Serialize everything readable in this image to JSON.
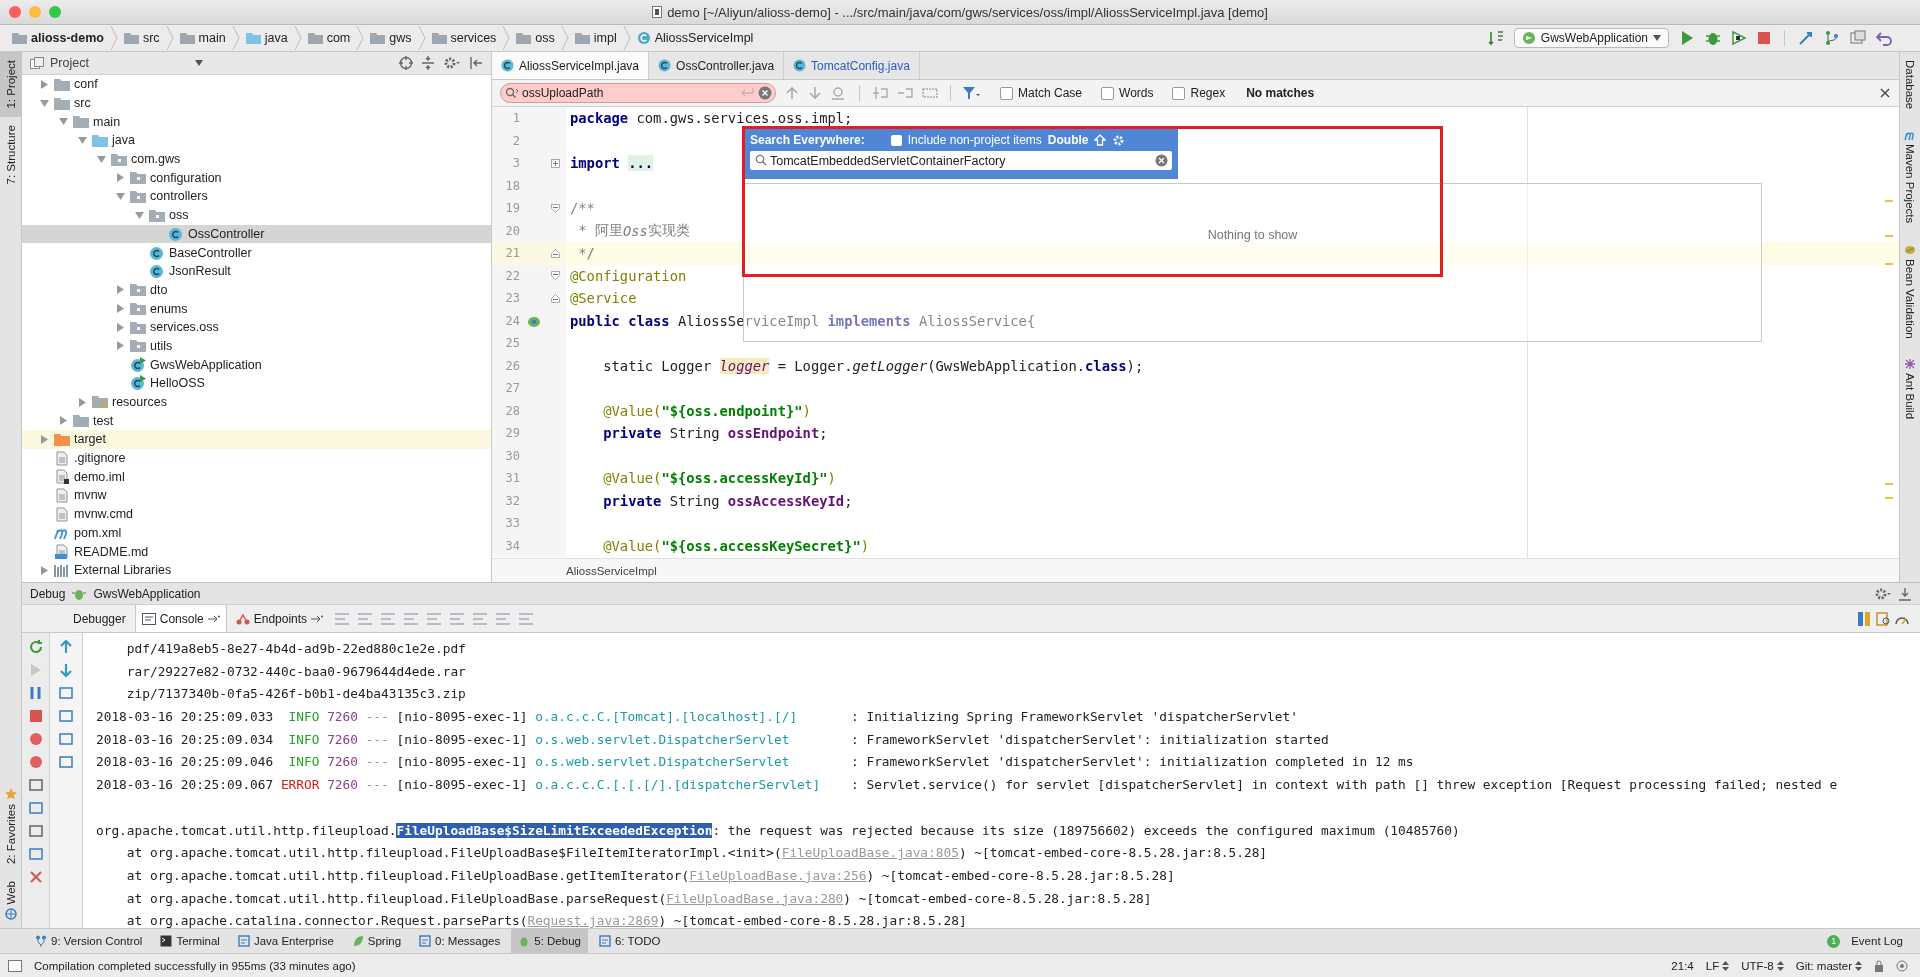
{
  "window": {
    "title": "demo [~/Aliyun/alioss-demo] - .../src/main/java/com/gws/services/oss/impl/AliossServiceImpl.java [demo]"
  },
  "breadcrumbs": [
    {
      "label": "alioss-demo",
      "kind": "module"
    },
    {
      "label": "src",
      "kind": "folder"
    },
    {
      "label": "main",
      "kind": "folder"
    },
    {
      "label": "java",
      "kind": "source"
    },
    {
      "label": "com",
      "kind": "folder"
    },
    {
      "label": "gws",
      "kind": "folder"
    },
    {
      "label": "services",
      "kind": "folder"
    },
    {
      "label": "oss",
      "kind": "folder"
    },
    {
      "label": "impl",
      "kind": "folder"
    },
    {
      "label": "AliossServiceImpl",
      "kind": "class"
    }
  ],
  "run_config": {
    "label": "GwsWebApplication"
  },
  "left_tool_strip": [
    {
      "label": "1: Project",
      "selected": true,
      "kind": "project"
    },
    {
      "label": "7: Structure",
      "selected": false,
      "kind": "structure"
    },
    {
      "label": "2: Favorites",
      "selected": false,
      "kind": "favorites"
    },
    {
      "label": "Web",
      "selected": false,
      "kind": "web"
    }
  ],
  "project_panel": {
    "title": "Project",
    "tree": [
      {
        "label": "conf",
        "kind": "folder",
        "expanded": false,
        "selected": false
      },
      {
        "label": "src",
        "kind": "folder",
        "expanded": true,
        "selected": false,
        "children": [
          {
            "label": "main",
            "kind": "folder",
            "expanded": true,
            "selected": false,
            "children": [
              {
                "label": "java",
                "kind": "source",
                "expanded": true,
                "selected": false,
                "children": [
                  {
                    "label": "com.gws",
                    "kind": "package",
                    "expanded": true,
                    "selected": false,
                    "children": [
                      {
                        "label": "configuration",
                        "kind": "package",
                        "expanded": false,
                        "selected": false
                      },
                      {
                        "label": "controllers",
                        "kind": "package",
                        "expanded": true,
                        "selected": false,
                        "children": [
                          {
                            "label": "oss",
                            "kind": "package",
                            "expanded": true,
                            "selected": false,
                            "children": [
                              {
                                "label": "OssController",
                                "kind": "class",
                                "selected": true
                              }
                            ]
                          },
                          {
                            "label": "BaseController",
                            "kind": "class",
                            "selected": false
                          },
                          {
                            "label": "JsonResult",
                            "kind": "class",
                            "selected": false
                          }
                        ]
                      },
                      {
                        "label": "dto",
                        "kind": "package",
                        "expanded": false,
                        "selected": false
                      },
                      {
                        "label": "enums",
                        "kind": "package",
                        "expanded": false,
                        "selected": false
                      },
                      {
                        "label": "services.oss",
                        "kind": "package",
                        "expanded": false,
                        "selected": false
                      },
                      {
                        "label": "utils",
                        "kind": "package",
                        "expanded": false,
                        "selected": false
                      },
                      {
                        "label": "GwsWebApplication",
                        "kind": "app-class",
                        "selected": false
                      },
                      {
                        "label": "HelloOSS",
                        "kind": "app-class",
                        "selected": false
                      }
                    ]
                  }
                ]
              },
              {
                "label": "resources",
                "kind": "resources",
                "expanded": false,
                "selected": false
              }
            ]
          },
          {
            "label": "test",
            "kind": "folder",
            "expanded": false,
            "selected": false
          }
        ]
      },
      {
        "label": "target",
        "kind": "excluded",
        "expanded": false,
        "selected": false
      },
      {
        "label": ".gitignore",
        "kind": "file",
        "selected": false
      },
      {
        "label": "demo.iml",
        "kind": "module-file",
        "selected": false
      },
      {
        "label": "mvnw",
        "kind": "file",
        "selected": false
      },
      {
        "label": "mvnw.cmd",
        "kind": "file",
        "selected": false
      },
      {
        "label": "pom.xml",
        "kind": "maven",
        "selected": false
      },
      {
        "label": "README.md",
        "kind": "markdown",
        "selected": false
      },
      {
        "label": "External Libraries",
        "kind": "library",
        "expanded": false,
        "selected": false
      }
    ]
  },
  "editor": {
    "tabs": [
      {
        "label": "AliossServiceImpl.java",
        "selected": true,
        "modified": false
      },
      {
        "label": "OssController.java",
        "selected": false,
        "modified": false
      },
      {
        "label": "TomcatConfig.java",
        "selected": false,
        "modified": true
      }
    ],
    "find_bar": {
      "value": "ossUploadPath",
      "match_found": false,
      "options": [
        {
          "label": "Match Case",
          "checked": false
        },
        {
          "label": "Words",
          "checked": false
        },
        {
          "label": "Regex",
          "checked": false
        }
      ],
      "result": "No matches"
    },
    "lines": [
      {
        "number": "1",
        "current": false,
        "tokens": [
          {
            "kind": "kw",
            "text": "package"
          },
          {
            "kind": "plain",
            "text": " com.gws.services.oss.impl;"
          }
        ]
      },
      {
        "number": "2",
        "current": false
      },
      {
        "number": "3",
        "current": false,
        "fold": {
          "kind": "collapsed"
        },
        "tokens": [
          {
            "kind": "kw",
            "text": "import "
          },
          {
            "kind": "folded",
            "text": "..."
          }
        ]
      },
      {
        "number": "18",
        "current": false
      },
      {
        "number": "19",
        "current": false,
        "fold": {
          "kind": "open"
        },
        "tokens": [
          {
            "kind": "comment",
            "text": "/**"
          }
        ]
      },
      {
        "number": "20",
        "current": false,
        "tokens": [
          {
            "kind": "comment",
            "text": " * 阿里"
          },
          {
            "kind": "comment-italic",
            "text": "Oss"
          },
          {
            "kind": "comment",
            "text": "实现类"
          }
        ]
      },
      {
        "number": "21",
        "current": true,
        "fold": {
          "kind": "close"
        },
        "tokens": [
          {
            "kind": "comment",
            "text": " */"
          }
        ]
      },
      {
        "number": "22",
        "current": false,
        "fold": {
          "kind": "open"
        },
        "tokens": [
          {
            "kind": "ann",
            "text": "@Configuration"
          }
        ]
      },
      {
        "number": "23",
        "current": false,
        "fold": {
          "kind": "close"
        },
        "tokens": [
          {
            "kind": "ann",
            "text": "@Service"
          }
        ]
      },
      {
        "number": "24",
        "current": false,
        "gutter": {
          "kind": "bean"
        },
        "tokens": [
          {
            "kind": "kw",
            "text": "public class"
          },
          {
            "kind": "plain",
            "text": " AliossServiceImpl "
          },
          {
            "kind": "kw",
            "text": "implements"
          },
          {
            "kind": "plain",
            "text": " AliossService{"
          }
        ]
      },
      {
        "number": "25",
        "current": false
      },
      {
        "number": "26",
        "current": false,
        "tokens": [
          {
            "kind": "plain",
            "text": "    static Logger "
          },
          {
            "kind": "var",
            "text": "logger"
          },
          {
            "kind": "plain",
            "text": " = Logger."
          },
          {
            "kind": "italic",
            "text": "getLogger"
          },
          {
            "kind": "plain",
            "text": "(GwsWebApplication."
          },
          {
            "kind": "kw",
            "text": "class"
          },
          {
            "kind": "plain",
            "text": ");"
          }
        ]
      },
      {
        "number": "27",
        "current": false
      },
      {
        "number": "28",
        "current": false,
        "tokens": [
          {
            "kind": "ann",
            "text": "    @Value("
          },
          {
            "kind": "str",
            "text": "\"${oss.endpoint}\""
          },
          {
            "kind": "ann",
            "text": ")"
          }
        ]
      },
      {
        "number": "29",
        "current": false,
        "tokens": [
          {
            "kind": "kw",
            "text": "    private"
          },
          {
            "kind": "plain",
            "text": " String "
          },
          {
            "kind": "field",
            "text": "ossEndpoint"
          },
          {
            "kind": "plain",
            "text": ";"
          }
        ]
      },
      {
        "number": "30",
        "current": false
      },
      {
        "number": "31",
        "current": false,
        "tokens": [
          {
            "kind": "ann",
            "text": "    @Value("
          },
          {
            "kind": "str",
            "text": "\"${oss.accessKeyId}\""
          },
          {
            "kind": "ann",
            "text": ")"
          }
        ]
      },
      {
        "number": "32",
        "current": false,
        "tokens": [
          {
            "kind": "kw",
            "text": "    private"
          },
          {
            "kind": "plain",
            "text": " String "
          },
          {
            "kind": "field",
            "text": "ossAccessKeyId"
          },
          {
            "kind": "plain",
            "text": ";"
          }
        ]
      },
      {
        "number": "33",
        "current": false
      },
      {
        "number": "34",
        "current": false,
        "tokens": [
          {
            "kind": "ann",
            "text": "    @Value("
          },
          {
            "kind": "str",
            "text": "\"${oss.accessKeySecret}\""
          },
          {
            "kind": "ann",
            "text": ")"
          }
        ]
      }
    ],
    "footer_breadcrumb": "AliossServiceImpl"
  },
  "search_everywhere": {
    "title": "Search Everywhere:",
    "include_non_project": {
      "label": "Include non-project items",
      "checked": false
    },
    "shortcut": "Double",
    "query": "TomcatEmbeddedServletContainerFactory",
    "empty_text": "Nothing to show"
  },
  "right_tool_strip": [
    {
      "label": "Database",
      "kind": "database"
    },
    {
      "label": "Maven Projects",
      "kind": "maven"
    },
    {
      "label": "Bean Validation",
      "kind": "bean"
    },
    {
      "label": "Ant Build",
      "kind": "ant"
    }
  ],
  "debug_panel": {
    "title": "Debug",
    "config": "GwsWebApplication",
    "tabs": [
      {
        "label": "Debugger",
        "selected": false,
        "kind": "plain"
      },
      {
        "label": "Console",
        "selected": true,
        "kind": "console"
      },
      {
        "label": "Endpoints",
        "selected": false,
        "kind": "endpoints"
      }
    ],
    "console": [
      {
        "kind": "path",
        "text": "pdf/419a8eb5-8e27-4b4d-ad9b-22ed880c1e2e.pdf"
      },
      {
        "kind": "path",
        "text": "rar/29227e82-0732-440c-baa0-9679644d4ede.rar"
      },
      {
        "kind": "path",
        "text": "zip/7137340b-0fa5-426f-b0b1-de4ba43135c3.zip"
      },
      {
        "kind": "log-info",
        "time": "2018-03-16 20:25:09.033",
        "severity": "INFO",
        "pid": "7260",
        "sep": "---",
        "thread": "[nio-8095-exec-1]",
        "logger": "o.a.c.c.C.[Tomcat].[localhost].[/]",
        "message": ": Initializing Spring FrameworkServlet 'dispatcherServlet'"
      },
      {
        "kind": "log-info",
        "time": "2018-03-16 20:25:09.034",
        "severity": "INFO",
        "pid": "7260",
        "sep": "---",
        "thread": "[nio-8095-exec-1]",
        "logger": "o.s.web.servlet.DispatcherServlet",
        "message": ": FrameworkServlet 'dispatcherServlet': initialization started"
      },
      {
        "kind": "log-info",
        "time": "2018-03-16 20:25:09.046",
        "severity": "INFO",
        "pid": "7260",
        "sep": "---",
        "thread": "[nio-8095-exec-1]",
        "logger": "o.s.web.servlet.DispatcherServlet",
        "message": ": FrameworkServlet 'dispatcherServlet': initialization completed in 12 ms"
      },
      {
        "kind": "log-error",
        "time": "2018-03-16 20:25:09.067",
        "severity": "ERROR",
        "pid": "7260",
        "sep": "---",
        "thread": "[nio-8095-exec-1]",
        "logger": "o.a.c.c.C.[.[.[/].[dispatcherServlet]",
        "message": ": Servlet.service() for servlet [dispatcherServlet] in context with path [] threw exception [Request processing failed; nested e"
      },
      {
        "kind": "gap"
      },
      {
        "kind": "exception",
        "prefix": "org.apache.tomcat.util.http.fileupload.",
        "highlight": "FileUploadBase$SizeLimitExceededException",
        "rest": ": the request was rejected because its size (189756602) exceeds the configured maximum (10485760)"
      },
      {
        "kind": "trace",
        "call": "at org.apache.tomcat.util.http.fileupload.FileUploadBase$FileItemIteratorImpl.<init>(",
        "link": "FileUploadBase.java:805",
        "rest": ") ~[tomcat-embed-core-8.5.28.jar:8.5.28]"
      },
      {
        "kind": "trace",
        "call": "at org.apache.tomcat.util.http.fileupload.FileUploadBase.getItemIterator(",
        "link": "FileUploadBase.java:256",
        "rest": ") ~[tomcat-embed-core-8.5.28.jar:8.5.28]"
      },
      {
        "kind": "trace",
        "call": "at org.apache.tomcat.util.http.fileupload.FileUploadBase.parseRequest(",
        "link": "FileUploadBase.java:280",
        "rest": ") ~[tomcat-embed-core-8.5.28.jar:8.5.28]"
      },
      {
        "kind": "trace",
        "call": "at org.apache.catalina.connector.Request.parseParts(",
        "link": "Request.java:2869",
        "rest": ") ~[tomcat-embed-core-8.5.28.jar:8.5.28]"
      }
    ]
  },
  "bottom_tool_windows": [
    {
      "label": "9: Version Control",
      "selected": false,
      "kind": "vcs"
    },
    {
      "label": "Terminal",
      "selected": false,
      "kind": "terminal"
    },
    {
      "label": "Java Enterprise",
      "selected": false,
      "kind": "enterprise"
    },
    {
      "label": "Spring",
      "selected": false,
      "kind": "spring"
    },
    {
      "label": "0: Messages",
      "selected": false,
      "kind": "messages"
    },
    {
      "label": "5: Debug",
      "selected": true,
      "kind": "debug"
    },
    {
      "label": "6: TODO",
      "selected": false,
      "kind": "todo"
    }
  ],
  "event_log": {
    "count": "1",
    "label": "Event Log"
  },
  "status_bar": {
    "message": "Compilation completed successfully in 955ms (33 minutes ago)",
    "position": "21:4",
    "line_separator": "LF",
    "encoding": "UTF-8",
    "vcs": "Git: master"
  }
}
